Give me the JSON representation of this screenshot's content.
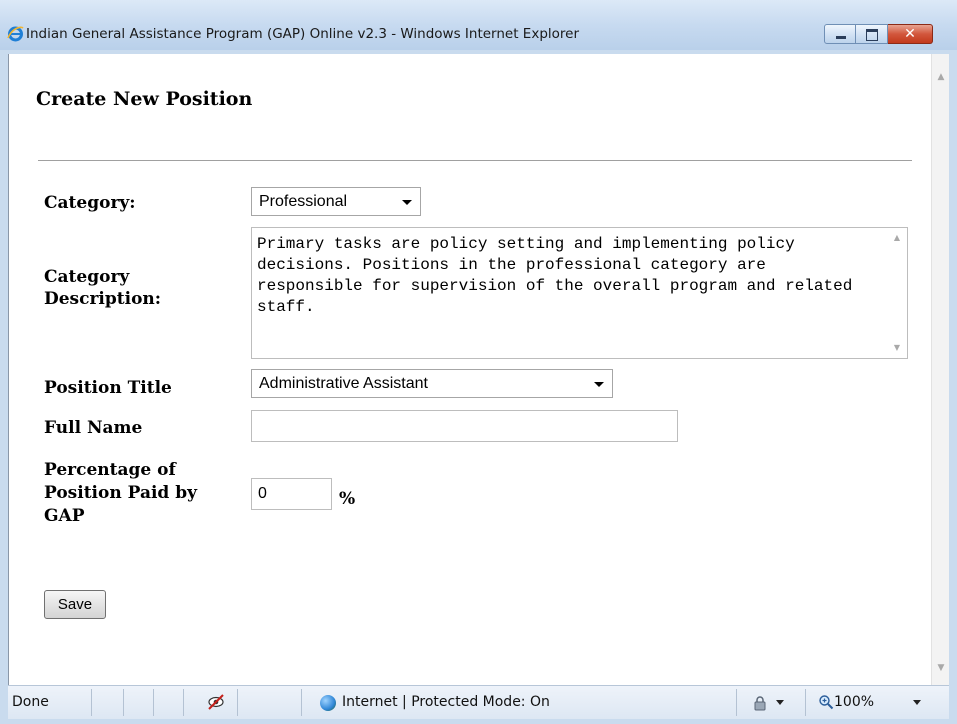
{
  "window": {
    "title": "Indian General Assistance Program (GAP) Online v2.3 - Windows Internet Explorer",
    "close_glyph": "✕"
  },
  "form": {
    "heading": "Create New Position",
    "category": {
      "label": "Category:",
      "value": "Professional"
    },
    "category_description": {
      "label": "Category Description:",
      "text": "Primary tasks are policy setting and implementing policy decisions. Positions in the professional category are responsible for supervision of the overall program and related staff."
    },
    "position_title": {
      "label": "Position Title",
      "value": "Administrative Assistant"
    },
    "full_name": {
      "label": "Full Name",
      "value": ""
    },
    "percentage": {
      "label": "Percentage of Position Paid by GAP",
      "value": "0",
      "unit": "%"
    },
    "save_label": "Save"
  },
  "statusbar": {
    "status": "Done",
    "zone": "Internet | Protected Mode: On",
    "zoom": "100%"
  },
  "icons": {
    "browser": "internet-explorer-icon",
    "privacy": "privacy-eye-icon",
    "zone": "globe-icon",
    "security": "lock-icon",
    "zoom": "magnifier-icon"
  }
}
